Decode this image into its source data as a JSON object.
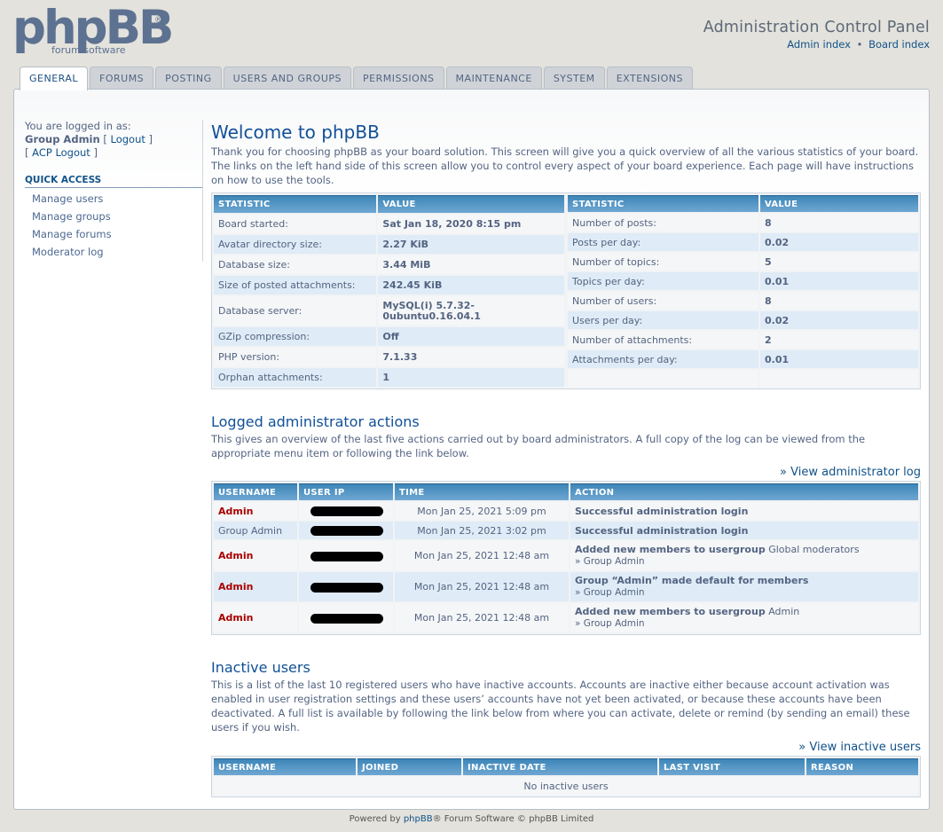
{
  "header": {
    "logo_word": "phpBB",
    "logo_sub": "forum software",
    "logo_reg": "®",
    "title": "Administration Control Panel",
    "link_admin_index": "Admin index",
    "link_sep": "•",
    "link_board_index": "Board index"
  },
  "tabs": [
    "GENERAL",
    "FORUMS",
    "POSTING",
    "USERS AND GROUPS",
    "PERMISSIONS",
    "MAINTENANCE",
    "SYSTEM",
    "EXTENSIONS"
  ],
  "menu": {
    "logged_in_as": "You are logged in as:",
    "user": "Group Admin",
    "logout_open": "[",
    "logout": "Logout",
    "logout_close": "]",
    "acp_logout": "ACP Logout",
    "quick_access": "QUICK ACCESS",
    "items": [
      "Manage users",
      "Manage groups",
      "Manage forums",
      "Moderator log"
    ]
  },
  "welcome": {
    "title": "Welcome to phpBB",
    "text": "Thank you for choosing phpBB as your board solution. This screen will give you a quick overview of all the various statistics of your board. The links on the left hand side of this screen allow you to control every aspect of your board experience. Each page will have instructions on how to use the tools."
  },
  "stats": {
    "head_statistic": "STATISTIC",
    "head_value": "VALUE",
    "left": [
      {
        "label": "Board started:",
        "value": "Sat Jan 18, 2020 8:15 pm"
      },
      {
        "label": "Avatar directory size:",
        "value": "2.27 KiB"
      },
      {
        "label": "Database size:",
        "value": "3.44 MiB"
      },
      {
        "label": "Size of posted attachments:",
        "value": "242.45 KiB"
      },
      {
        "label": "Database server:",
        "value": "MySQL(i) 5.7.32-0ubuntu0.16.04.1"
      },
      {
        "label": "GZip compression:",
        "value": "Off"
      },
      {
        "label": "PHP version:",
        "value": "7.1.33"
      },
      {
        "label": "Orphan attachments:",
        "value": "1"
      }
    ],
    "right": [
      {
        "label": "Number of posts:",
        "value": "8"
      },
      {
        "label": "Posts per day:",
        "value": "0.02"
      },
      {
        "label": "Number of topics:",
        "value": "5"
      },
      {
        "label": "Topics per day:",
        "value": "0.01"
      },
      {
        "label": "Number of users:",
        "value": "8"
      },
      {
        "label": "Users per day:",
        "value": "0.02"
      },
      {
        "label": "Number of attachments:",
        "value": "2"
      },
      {
        "label": "Attachments per day:",
        "value": "0.01"
      }
    ]
  },
  "logs": {
    "title": "Logged administrator actions",
    "text": "This gives an overview of the last five actions carried out by board administrators. A full copy of the log can be viewed from the appropriate menu item or following the link below.",
    "view_link": "» View administrator log",
    "headers": [
      "USERNAME",
      "USER IP",
      "TIME",
      "ACTION"
    ],
    "rows": [
      {
        "user": "Admin",
        "time": "Mon Jan 25, 2021 5:09 pm",
        "action": "Successful administration login",
        "extra": "",
        "sub": ""
      },
      {
        "user": "Group Admin",
        "time": "Mon Jan 25, 2021 3:02 pm",
        "action": "Successful administration login",
        "extra": "",
        "sub": ""
      },
      {
        "user": "Admin",
        "time": "Mon Jan 25, 2021 12:48 am",
        "action": "Added new members to usergroup",
        "extra": "Global moderators",
        "sub": "» Group Admin"
      },
      {
        "user": "Admin",
        "time": "Mon Jan 25, 2021 12:48 am",
        "action": "Group “Admin” made default for members",
        "extra": "",
        "sub": "» Group Admin"
      },
      {
        "user": "Admin",
        "time": "Mon Jan 25, 2021 12:48 am",
        "action": "Added new members to usergroup",
        "extra": "Admin",
        "sub": "» Group Admin"
      }
    ]
  },
  "inactive": {
    "title": "Inactive users",
    "text": "This is a list of the last 10 registered users who have inactive accounts. Accounts are inactive either because account activation was enabled in user registration settings and these users’ accounts have not yet been activated, or because these accounts have been deactivated. A full list is available by following the link below from where you can activate, delete or remind (by sending an email) these users if you wish.",
    "view_link": "» View inactive users",
    "headers": [
      "USERNAME",
      "JOINED",
      "INACTIVE DATE",
      "LAST VISIT",
      "REASON"
    ],
    "empty": "No inactive users"
  },
  "footer": {
    "prefix": "Powered by",
    "brand": "phpBB",
    "suffix": "® Forum Software © phpBB Limited"
  },
  "colors": {
    "accent": "#105289",
    "header_bar": "#3d86b8",
    "admin_name": "#aa0000"
  }
}
